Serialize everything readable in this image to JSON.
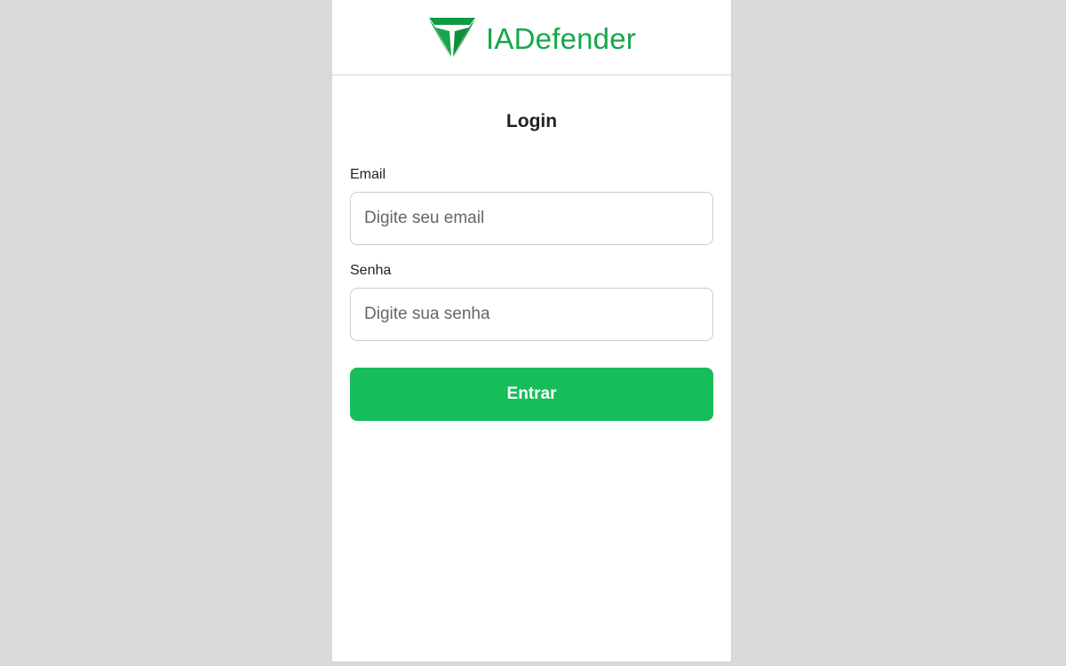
{
  "brand": {
    "name": "IADefender",
    "color": "#17a74a",
    "icon": "shield-triangle-icon"
  },
  "login": {
    "title": "Login",
    "email_label": "Email",
    "email_placeholder": "Digite seu email",
    "email_value": "",
    "password_label": "Senha",
    "password_placeholder": "Digite sua senha",
    "password_value": "",
    "submit_label": "Entrar",
    "submit_color": "#17bd5a"
  }
}
